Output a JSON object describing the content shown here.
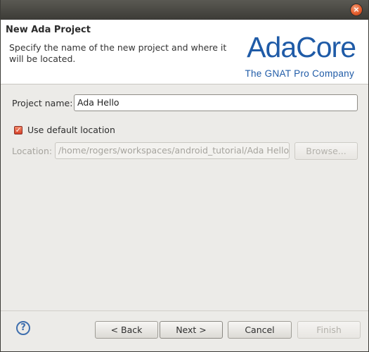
{
  "window": {
    "close_glyph": "×"
  },
  "header": {
    "title": "New Ada Project",
    "description": "Specify the name of the new project and where it will be located.",
    "logo": {
      "word": "AdaCore",
      "tagline": "The GNAT Pro Company"
    }
  },
  "form": {
    "project_name_label": "Project name:",
    "project_name_value": "Ada Hello",
    "use_default_label": "Use default location",
    "use_default_checked": true,
    "location_label": "Location:",
    "location_value": "/home/rogers/workspaces/android_tutorial/Ada Hello",
    "browse_label": "Browse..."
  },
  "footer": {
    "help_glyph": "?",
    "back_label": "< Back",
    "next_label": "Next >",
    "cancel_label": "Cancel",
    "finish_label": "Finish"
  },
  "icons": [
    "close-icon",
    "help-icon",
    "checkbox-checked-icon"
  ],
  "colors": {
    "brand": "#1f5ba7",
    "checkbox": "#d8432a",
    "help": "#3f6fae"
  }
}
